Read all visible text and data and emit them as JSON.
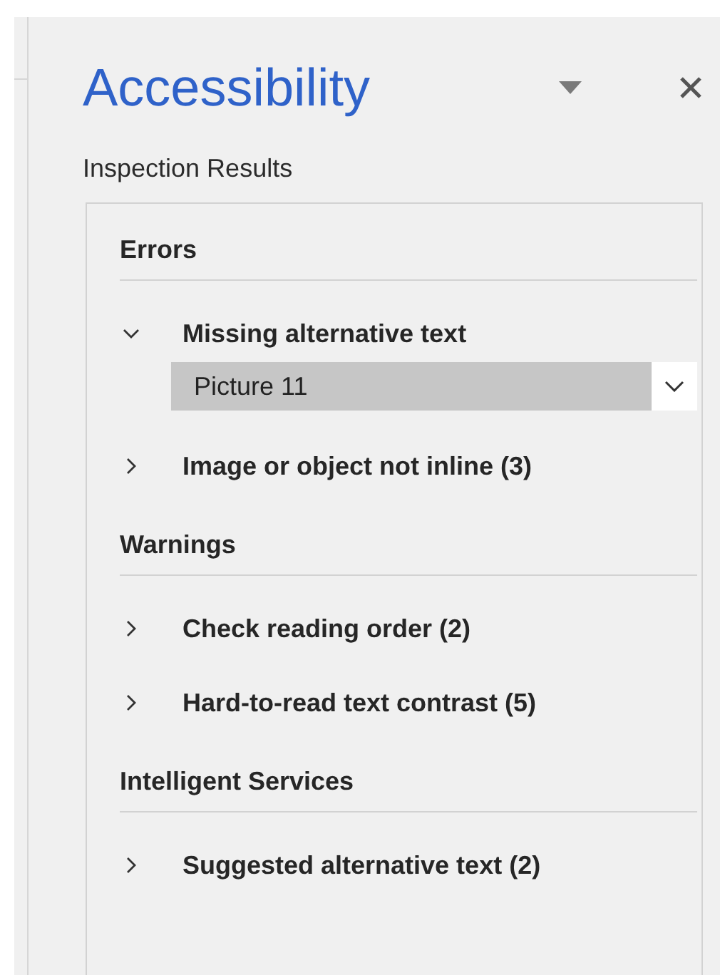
{
  "pane": {
    "title": "Accessibility",
    "subtitle": "Inspection Results"
  },
  "sections": [
    {
      "title": "Errors",
      "items": [
        {
          "label": "Missing alternative text",
          "expanded": true,
          "children": [
            {
              "label": "Picture 11",
              "selected": true
            }
          ]
        },
        {
          "label": "Image or object not inline (3)",
          "expanded": false
        }
      ]
    },
    {
      "title": "Warnings",
      "items": [
        {
          "label": "Check reading order (2)",
          "expanded": false
        },
        {
          "label": "Hard-to-read text contrast (5)",
          "expanded": false
        }
      ]
    },
    {
      "title": "Intelligent Services",
      "items": [
        {
          "label": "Suggested alternative text (2)",
          "expanded": false
        }
      ]
    }
  ]
}
